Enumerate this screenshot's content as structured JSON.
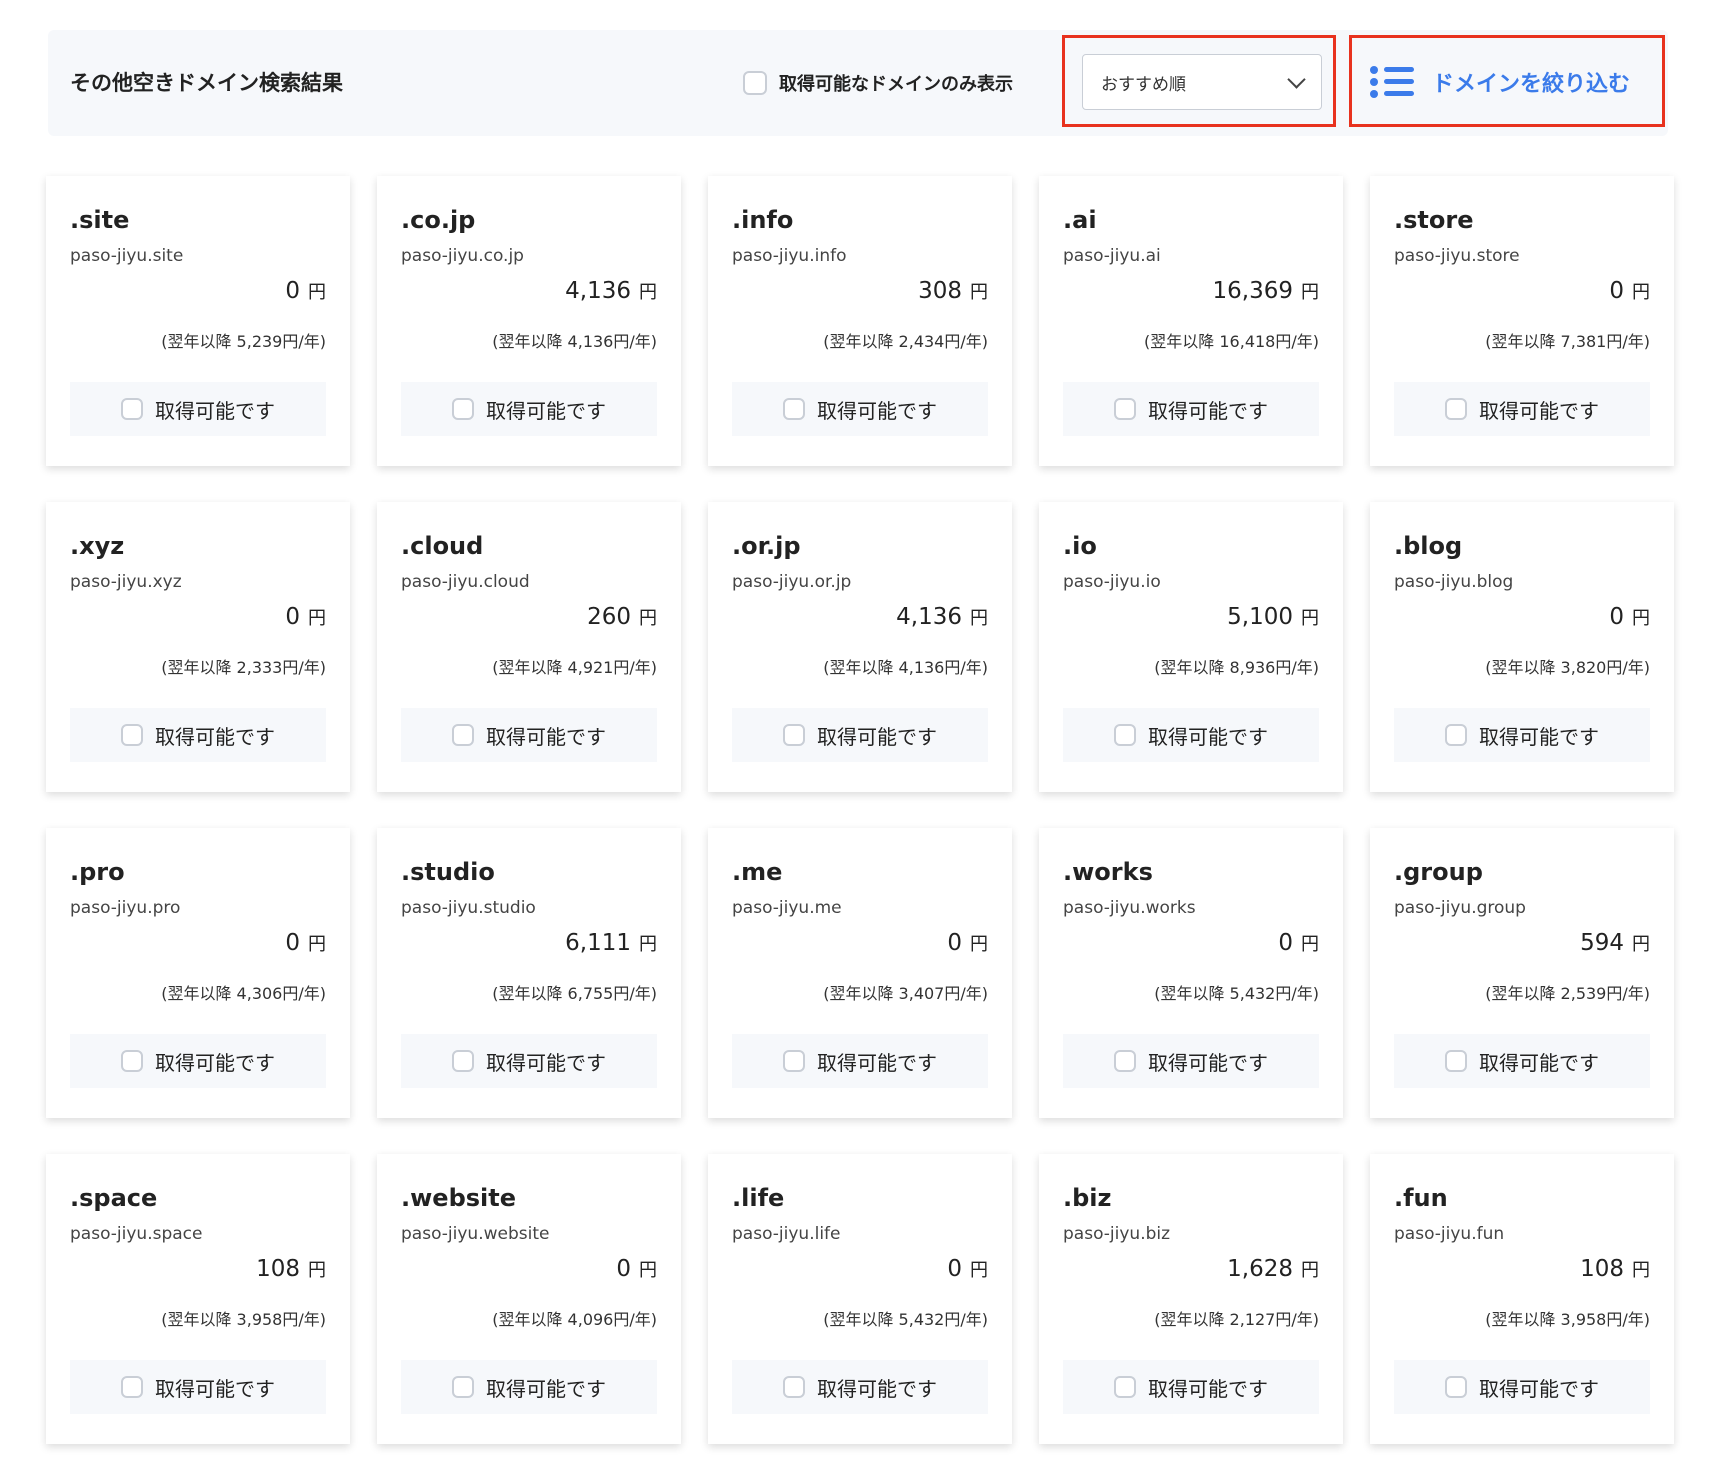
{
  "header": {
    "title": "その他空きドメイン検索結果",
    "available_only_label": "取得可能なドメインのみ表示",
    "sort_value": "おすすめ順",
    "narrow_label": "ドメインを絞り込む"
  },
  "colors": {
    "accent": "#3b7bea",
    "highlight": "#e8321e"
  },
  "currency": "円",
  "available_label": "取得可能です",
  "domains": [
    {
      "tld": ".site",
      "domain": "paso-jiyu.site",
      "price": "0",
      "renewal": "(翌年以降 5,239円/年)"
    },
    {
      "tld": ".co.jp",
      "domain": "paso-jiyu.co.jp",
      "price": "4,136",
      "renewal": "(翌年以降 4,136円/年)"
    },
    {
      "tld": ".info",
      "domain": "paso-jiyu.info",
      "price": "308",
      "renewal": "(翌年以降 2,434円/年)"
    },
    {
      "tld": ".ai",
      "domain": "paso-jiyu.ai",
      "price": "16,369",
      "renewal": "(翌年以降 16,418円/年)"
    },
    {
      "tld": ".store",
      "domain": "paso-jiyu.store",
      "price": "0",
      "renewal": "(翌年以降 7,381円/年)"
    },
    {
      "tld": ".xyz",
      "domain": "paso-jiyu.xyz",
      "price": "0",
      "renewal": "(翌年以降 2,333円/年)"
    },
    {
      "tld": ".cloud",
      "domain": "paso-jiyu.cloud",
      "price": "260",
      "renewal": "(翌年以降 4,921円/年)"
    },
    {
      "tld": ".or.jp",
      "domain": "paso-jiyu.or.jp",
      "price": "4,136",
      "renewal": "(翌年以降 4,136円/年)"
    },
    {
      "tld": ".io",
      "domain": "paso-jiyu.io",
      "price": "5,100",
      "renewal": "(翌年以降 8,936円/年)"
    },
    {
      "tld": ".blog",
      "domain": "paso-jiyu.blog",
      "price": "0",
      "renewal": "(翌年以降 3,820円/年)"
    },
    {
      "tld": ".pro",
      "domain": "paso-jiyu.pro",
      "price": "0",
      "renewal": "(翌年以降 4,306円/年)"
    },
    {
      "tld": ".studio",
      "domain": "paso-jiyu.studio",
      "price": "6,111",
      "renewal": "(翌年以降 6,755円/年)"
    },
    {
      "tld": ".me",
      "domain": "paso-jiyu.me",
      "price": "0",
      "renewal": "(翌年以降 3,407円/年)"
    },
    {
      "tld": ".works",
      "domain": "paso-jiyu.works",
      "price": "0",
      "renewal": "(翌年以降 5,432円/年)"
    },
    {
      "tld": ".group",
      "domain": "paso-jiyu.group",
      "price": "594",
      "renewal": "(翌年以降 2,539円/年)"
    },
    {
      "tld": ".space",
      "domain": "paso-jiyu.space",
      "price": "108",
      "renewal": "(翌年以降 3,958円/年)"
    },
    {
      "tld": ".website",
      "domain": "paso-jiyu.website",
      "price": "0",
      "renewal": "(翌年以降 4,096円/年)"
    },
    {
      "tld": ".life",
      "domain": "paso-jiyu.life",
      "price": "0",
      "renewal": "(翌年以降 5,432円/年)"
    },
    {
      "tld": ".biz",
      "domain": "paso-jiyu.biz",
      "price": "1,628",
      "renewal": "(翌年以降 2,127円/年)"
    },
    {
      "tld": ".fun",
      "domain": "paso-jiyu.fun",
      "price": "108",
      "renewal": "(翌年以降 3,958円/年)"
    }
  ]
}
